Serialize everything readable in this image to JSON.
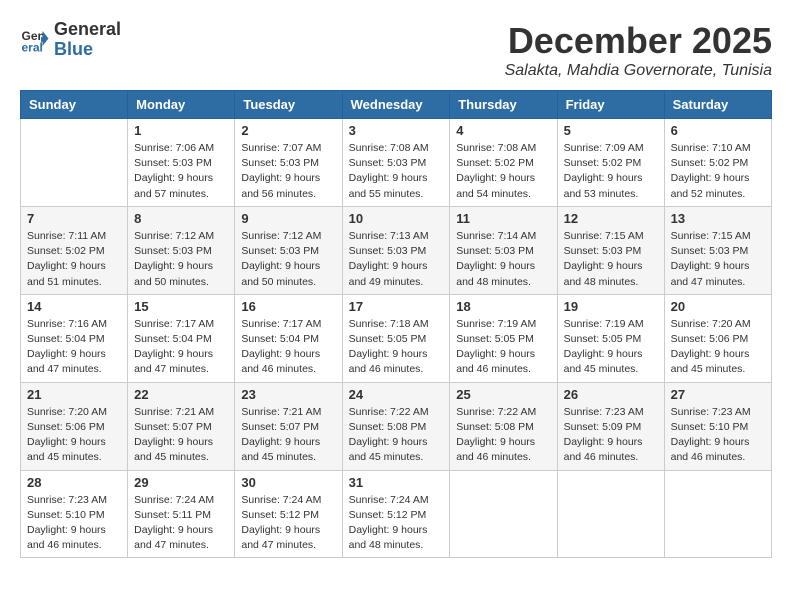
{
  "logo": {
    "general": "General",
    "blue": "Blue"
  },
  "title": "December 2025",
  "location": "Salakta, Mahdia Governorate, Tunisia",
  "weekdays": [
    "Sunday",
    "Monday",
    "Tuesday",
    "Wednesday",
    "Thursday",
    "Friday",
    "Saturday"
  ],
  "weeks": [
    [
      {
        "day": "",
        "info": ""
      },
      {
        "day": "1",
        "info": "Sunrise: 7:06 AM\nSunset: 5:03 PM\nDaylight: 9 hours\nand 57 minutes."
      },
      {
        "day": "2",
        "info": "Sunrise: 7:07 AM\nSunset: 5:03 PM\nDaylight: 9 hours\nand 56 minutes."
      },
      {
        "day": "3",
        "info": "Sunrise: 7:08 AM\nSunset: 5:03 PM\nDaylight: 9 hours\nand 55 minutes."
      },
      {
        "day": "4",
        "info": "Sunrise: 7:08 AM\nSunset: 5:02 PM\nDaylight: 9 hours\nand 54 minutes."
      },
      {
        "day": "5",
        "info": "Sunrise: 7:09 AM\nSunset: 5:02 PM\nDaylight: 9 hours\nand 53 minutes."
      },
      {
        "day": "6",
        "info": "Sunrise: 7:10 AM\nSunset: 5:02 PM\nDaylight: 9 hours\nand 52 minutes."
      }
    ],
    [
      {
        "day": "7",
        "info": "Sunrise: 7:11 AM\nSunset: 5:02 PM\nDaylight: 9 hours\nand 51 minutes."
      },
      {
        "day": "8",
        "info": "Sunrise: 7:12 AM\nSunset: 5:03 PM\nDaylight: 9 hours\nand 50 minutes."
      },
      {
        "day": "9",
        "info": "Sunrise: 7:12 AM\nSunset: 5:03 PM\nDaylight: 9 hours\nand 50 minutes."
      },
      {
        "day": "10",
        "info": "Sunrise: 7:13 AM\nSunset: 5:03 PM\nDaylight: 9 hours\nand 49 minutes."
      },
      {
        "day": "11",
        "info": "Sunrise: 7:14 AM\nSunset: 5:03 PM\nDaylight: 9 hours\nand 48 minutes."
      },
      {
        "day": "12",
        "info": "Sunrise: 7:15 AM\nSunset: 5:03 PM\nDaylight: 9 hours\nand 48 minutes."
      },
      {
        "day": "13",
        "info": "Sunrise: 7:15 AM\nSunset: 5:03 PM\nDaylight: 9 hours\nand 47 minutes."
      }
    ],
    [
      {
        "day": "14",
        "info": "Sunrise: 7:16 AM\nSunset: 5:04 PM\nDaylight: 9 hours\nand 47 minutes."
      },
      {
        "day": "15",
        "info": "Sunrise: 7:17 AM\nSunset: 5:04 PM\nDaylight: 9 hours\nand 47 minutes."
      },
      {
        "day": "16",
        "info": "Sunrise: 7:17 AM\nSunset: 5:04 PM\nDaylight: 9 hours\nand 46 minutes."
      },
      {
        "day": "17",
        "info": "Sunrise: 7:18 AM\nSunset: 5:05 PM\nDaylight: 9 hours\nand 46 minutes."
      },
      {
        "day": "18",
        "info": "Sunrise: 7:19 AM\nSunset: 5:05 PM\nDaylight: 9 hours\nand 46 minutes."
      },
      {
        "day": "19",
        "info": "Sunrise: 7:19 AM\nSunset: 5:05 PM\nDaylight: 9 hours\nand 45 minutes."
      },
      {
        "day": "20",
        "info": "Sunrise: 7:20 AM\nSunset: 5:06 PM\nDaylight: 9 hours\nand 45 minutes."
      }
    ],
    [
      {
        "day": "21",
        "info": "Sunrise: 7:20 AM\nSunset: 5:06 PM\nDaylight: 9 hours\nand 45 minutes."
      },
      {
        "day": "22",
        "info": "Sunrise: 7:21 AM\nSunset: 5:07 PM\nDaylight: 9 hours\nand 45 minutes."
      },
      {
        "day": "23",
        "info": "Sunrise: 7:21 AM\nSunset: 5:07 PM\nDaylight: 9 hours\nand 45 minutes."
      },
      {
        "day": "24",
        "info": "Sunrise: 7:22 AM\nSunset: 5:08 PM\nDaylight: 9 hours\nand 45 minutes."
      },
      {
        "day": "25",
        "info": "Sunrise: 7:22 AM\nSunset: 5:08 PM\nDaylight: 9 hours\nand 46 minutes."
      },
      {
        "day": "26",
        "info": "Sunrise: 7:23 AM\nSunset: 5:09 PM\nDaylight: 9 hours\nand 46 minutes."
      },
      {
        "day": "27",
        "info": "Sunrise: 7:23 AM\nSunset: 5:10 PM\nDaylight: 9 hours\nand 46 minutes."
      }
    ],
    [
      {
        "day": "28",
        "info": "Sunrise: 7:23 AM\nSunset: 5:10 PM\nDaylight: 9 hours\nand 46 minutes."
      },
      {
        "day": "29",
        "info": "Sunrise: 7:24 AM\nSunset: 5:11 PM\nDaylight: 9 hours\nand 47 minutes."
      },
      {
        "day": "30",
        "info": "Sunrise: 7:24 AM\nSunset: 5:12 PM\nDaylight: 9 hours\nand 47 minutes."
      },
      {
        "day": "31",
        "info": "Sunrise: 7:24 AM\nSunset: 5:12 PM\nDaylight: 9 hours\nand 48 minutes."
      },
      {
        "day": "",
        "info": ""
      },
      {
        "day": "",
        "info": ""
      },
      {
        "day": "",
        "info": ""
      }
    ]
  ]
}
